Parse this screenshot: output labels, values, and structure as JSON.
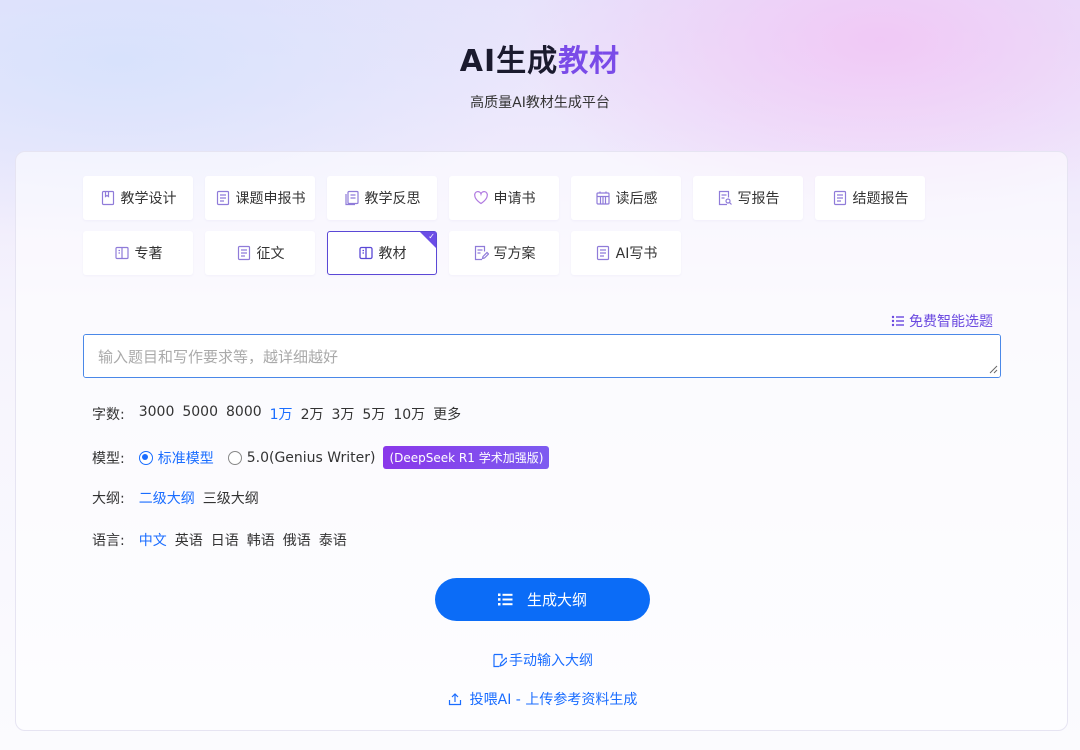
{
  "header": {
    "title_main": "AI生成",
    "title_accent": "教材",
    "subtitle": "高质量AI教材生成平台"
  },
  "categories": {
    "row1": [
      {
        "label": "教学设计",
        "icon": "notebook-icon"
      },
      {
        "label": "课题申报书",
        "icon": "document-icon"
      },
      {
        "label": "教学反思",
        "icon": "pages-icon"
      },
      {
        "label": "申请书",
        "icon": "heart-icon"
      },
      {
        "label": "读后感",
        "icon": "calendar-icon"
      },
      {
        "label": "写报告",
        "icon": "report-search-icon"
      },
      {
        "label": "结题报告",
        "icon": "document-icon"
      }
    ],
    "row2": [
      {
        "label": "专著",
        "icon": "book-icon"
      },
      {
        "label": "征文",
        "icon": "document-icon"
      },
      {
        "label": "教材",
        "icon": "open-book-icon",
        "active": true
      },
      {
        "label": "写方案",
        "icon": "edit-doc-icon"
      },
      {
        "label": "AI写书",
        "icon": "document-icon"
      }
    ]
  },
  "free_topic": "免费智能选题",
  "prompt": {
    "placeholder": "输入题目和写作要求等，越详细越好",
    "value": ""
  },
  "word_count": {
    "label": "字数:",
    "options": [
      "3000",
      "5000",
      "8000",
      "1万",
      "2万",
      "3万",
      "5万",
      "10万",
      "更多"
    ],
    "selected": "1万"
  },
  "model": {
    "label": "模型:",
    "options": [
      "标准模型",
      "5.0(Genius Writer)"
    ],
    "selected": "标准模型",
    "badge": "(DeepSeek R1 学术加强版)"
  },
  "outline": {
    "label": "大纲:",
    "options": [
      "二级大纲",
      "三级大纲"
    ],
    "selected": "二级大纲"
  },
  "language": {
    "label": "语言:",
    "options": [
      "中文",
      "英语",
      "日语",
      "韩语",
      "俄语",
      "泰语"
    ],
    "selected": "中文"
  },
  "actions": {
    "generate": "生成大纲",
    "manual": "手动输入大纲",
    "upload": "投喂AI - 上传参考资料生成"
  },
  "colors": {
    "accent_purple": "#7a4be8",
    "primary_blue": "#0b6cf7",
    "selected_text": "#1a6dff"
  }
}
